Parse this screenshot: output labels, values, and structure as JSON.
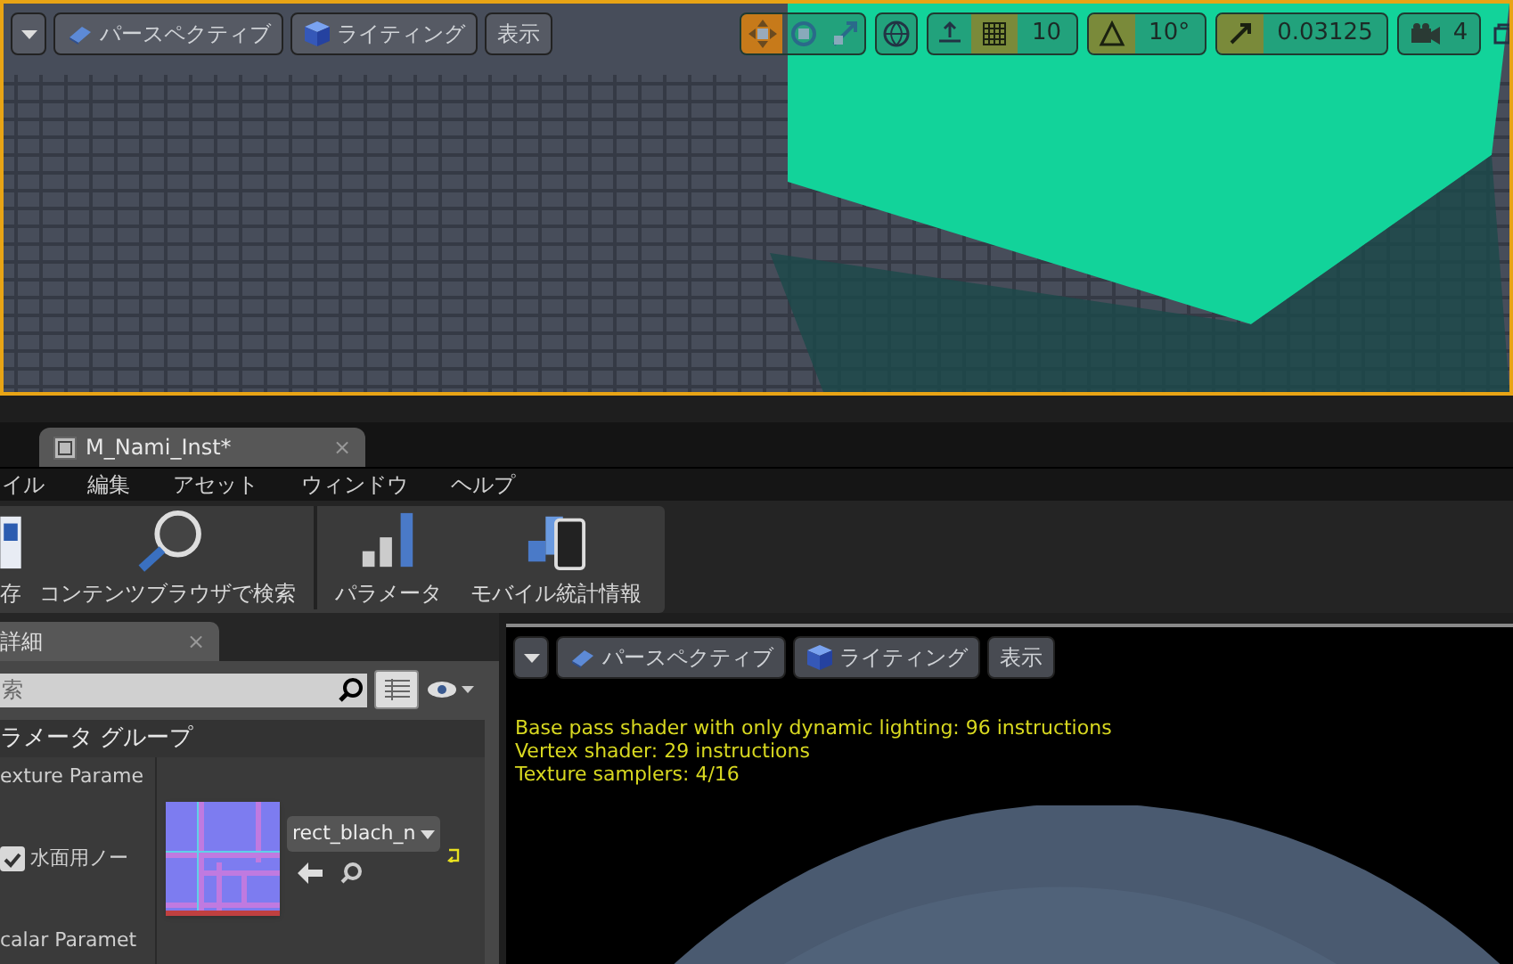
{
  "level_viewport": {
    "view_buttons": [
      {
        "label": "パースペクティブ"
      },
      {
        "label": "ライティング"
      },
      {
        "label": "表示"
      }
    ],
    "transform_tools": [
      {
        "selected": true
      },
      {
        "selected": false
      },
      {
        "selected": false
      }
    ],
    "grid_snap": {
      "on": true,
      "value": "10"
    },
    "rotation_snap": {
      "on": true,
      "value": "10°"
    },
    "scale_snap": {
      "on": true,
      "value": "0.03125"
    },
    "camera_speed": "4"
  },
  "editor_tab": {
    "title": "M_Nami_Inst*",
    "close": "×"
  },
  "menu": [
    "イル",
    "編集",
    "アセット",
    "ウィンドウ",
    "ヘルプ"
  ],
  "toolbar": [
    {
      "label": "存"
    },
    {
      "label": "コンテンツブラウザで検索"
    },
    {
      "label": "パラメータ"
    },
    {
      "label": "モバイル統計情報"
    }
  ],
  "details": {
    "tab": "詳細",
    "tab_close": "×",
    "search_placeholder": "索",
    "group_header": "ラメータ グループ",
    "categories": [
      {
        "name": "exture Parame",
        "parameter": {
          "label": "水面用ノー",
          "checked": true,
          "asset": "rect_blach_n"
        }
      },
      {
        "name": "calar Paramet"
      }
    ]
  },
  "preview_viewport": {
    "view_buttons": [
      {
        "label": "パースペクティブ"
      },
      {
        "label": "ライティング"
      },
      {
        "label": "表示"
      }
    ],
    "stats": [
      "Base pass shader with only dynamic lighting: 96 instructions",
      "Vertex shader: 29 instructions",
      "Texture samplers: 4/16"
    ]
  }
}
